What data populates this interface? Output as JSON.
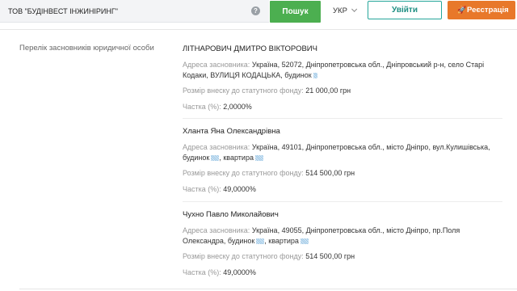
{
  "header": {
    "search_value": "ТОВ \"БУДІНВЕСТ ІНЖИНІРИНГ\"",
    "help_icon": "question-circle-icon",
    "search_button": "Пошук",
    "language": "УКР",
    "login_button": "Увійти",
    "register_button": "Реєстрація",
    "register_icon": "rocket-icon",
    "colors": {
      "search_green": "#4caf50",
      "login_teal": "#26a69a",
      "register_orange": "#e8782a"
    }
  },
  "section": {
    "label": "Перелік засновників юридичної особи"
  },
  "founders": [
    {
      "name": "ЛІТНАРОВИЧ ДМИТРО ВІКТОРОВИЧ",
      "address_label": "Адреса засновника:",
      "address_line1": "Україна, 52072, Дніпропетровська обл., Дніпровський р-н, село Старі",
      "address_line2": "Кодаки, ВУЛИЦЯ КОДАЦЬКА, будинок",
      "capital_label": "Розмір внеску до статутного фонду:",
      "capital_value": "21 000,00 грн",
      "share_label": "Частка (%):",
      "share_value": "2,0000%"
    },
    {
      "name": "Хланта Яна Олександрівна",
      "address_label": "Адреса засновника:",
      "address_line1": "Україна, 49101, Дніпропетровська обл., місто Дніпро, вул.Кулишівська,",
      "address_line2a": "будинок",
      "address_line2b": ", квартира",
      "capital_label": "Розмір внеску до статутного фонду:",
      "capital_value": "514 500,00 грн",
      "share_label": "Частка (%):",
      "share_value": "49,0000%"
    },
    {
      "name": "Чухно Павло Миколайович",
      "address_label": "Адреса засновника:",
      "address_line1": "Україна, 49055, Дніпропетровська обл., місто Дніпро, пр.Поля",
      "address_line2a": "Олександра, будинок",
      "address_line2b": ", квартира",
      "capital_label": "Розмір внеску до статутного фонду:",
      "capital_value": "514 500,00 грн",
      "share_label": "Частка (%):",
      "share_value": "49,0000%"
    }
  ]
}
